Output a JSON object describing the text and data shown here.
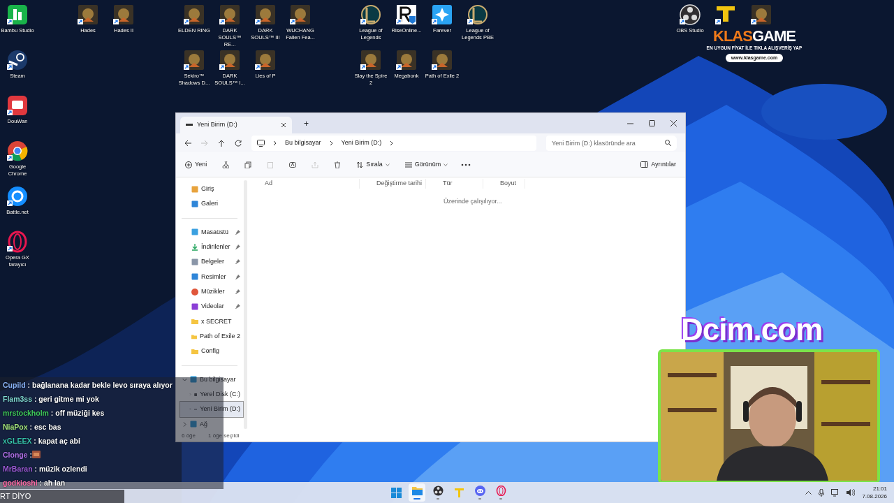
{
  "desktop_icons": [
    {
      "label": "Bambu Studio",
      "kind": "bambu"
    },
    {
      "label": "Steam",
      "kind": "steam"
    },
    {
      "label": "DouWan",
      "kind": "douwan"
    },
    {
      "label": "Google Chrome",
      "kind": "chrome"
    },
    {
      "label": "Battle.net",
      "kind": "battlenet"
    },
    {
      "label": "Opera GX tarayıcı",
      "kind": "opera"
    },
    {
      "label": "Hades",
      "kind": "game"
    },
    {
      "label": "Hades II",
      "kind": "game"
    },
    {
      "label": "ELDEN RING",
      "kind": "game"
    },
    {
      "label": "DARK SOULS™ RE...",
      "kind": "game"
    },
    {
      "label": "DARK SOULS™ III",
      "kind": "game"
    },
    {
      "label": "WUCHANG Fallen Fea...",
      "kind": "game"
    },
    {
      "label": "Sekiro™ Shadows D...",
      "kind": "game"
    },
    {
      "label": "DARK SOULS™ I...",
      "kind": "game"
    },
    {
      "label": "Lies of P",
      "kind": "game"
    },
    {
      "label": "League of Legends",
      "kind": "league"
    },
    {
      "label": "RiseOnline...",
      "kind": "rise"
    },
    {
      "label": "Farever",
      "kind": "farever"
    },
    {
      "label": "League of Legends PBE",
      "kind": "league"
    },
    {
      "label": "Slay the Spire 2",
      "kind": "game"
    },
    {
      "label": "Megabonk",
      "kind": "game"
    },
    {
      "label": "Path of Exile 2",
      "kind": "game"
    },
    {
      "label": "OBS Studio",
      "kind": "obs"
    },
    {
      "kind": "tft"
    },
    {
      "kind": "game"
    }
  ],
  "ad": {
    "brand_left": "KLAS",
    "brand_right": "GAME",
    "tagline": "EN UYGUN FİYAT İLE TIKLA ALIŞVERİŞ YAP",
    "url": "www.klasgame.com"
  },
  "explorer": {
    "tab_title": "Yeni Birim (D:)",
    "new_tab": "+",
    "breadcrumbs": [
      "Bu bilgisayar",
      "Yeni Birim (D:)"
    ],
    "search": {
      "placeholder": "Yeni Birim (D:) klasöründe ara"
    },
    "toolbar": {
      "new": "Yeni",
      "sort": "Sırala",
      "view": "Görünüm",
      "details": "Ayrıntılar"
    },
    "sidebar_top": [
      {
        "label": "Giriş",
        "kind": "home"
      },
      {
        "label": "Galeri",
        "kind": "gallery"
      }
    ],
    "quick_access": [
      {
        "label": "Masaüstü",
        "kind": "desktop",
        "pinned": true
      },
      {
        "label": "İndirilenler",
        "kind": "downloads",
        "pinned": true
      },
      {
        "label": "Belgeler",
        "kind": "documents",
        "pinned": true
      },
      {
        "label": "Resimler",
        "kind": "pictures",
        "pinned": true
      },
      {
        "label": "Müzikler",
        "kind": "music",
        "pinned": true
      },
      {
        "label": "Videolar",
        "kind": "videos",
        "pinned": true
      },
      {
        "label": "x SECRET",
        "kind": "folder",
        "pinned": false
      },
      {
        "label": "Path of Exile 2",
        "kind": "folder",
        "pinned": false
      },
      {
        "label": "Config",
        "kind": "folder",
        "pinned": false
      }
    ],
    "tree": [
      {
        "label": "Bu bilgisayar",
        "expanded": true,
        "selected": false,
        "children": [
          {
            "label": "Yerel Disk (C:)",
            "expanded": false,
            "selected": false
          },
          {
            "label": "Yeni Birim (D:)",
            "expanded": false,
            "selected": true
          }
        ]
      },
      {
        "label": "Ağ",
        "expanded": false,
        "selected": false
      }
    ],
    "columns": [
      "Ad",
      "Değiştirme tarihi",
      "Tür",
      "Boyut"
    ],
    "message": "Üzerinde çalışılıyor...",
    "status_bar": [
      "6 öğe",
      "1 öğe seçildi"
    ]
  },
  "chat": [
    {
      "user": "Cupild",
      "color": "#8ab4f8",
      "text": ": bağlanana kadar bekle levo sıraya alıyor"
    },
    {
      "user": "Flam3ss",
      "color": "#7fd8d0",
      "text": ": geri gitme mi yok"
    },
    {
      "user": "mrstockholm",
      "color": "#3ec95a",
      "text": ": off müziği kes"
    },
    {
      "user": "NiaPox",
      "color": "#a3e37a",
      "text": ": esc bas"
    },
    {
      "user": "xGLEEX",
      "color": "#35c0a8",
      "text": ": kapat aç abi"
    },
    {
      "user": "Clonge",
      "color": "#b070e8",
      "text": ":",
      "kind": "emote"
    },
    {
      "user": "MrBaran",
      "color": "#9b59d6",
      "text": ": müzik ozlendi"
    },
    {
      "user": "godkioshi",
      "color": "#ff6aa8",
      "text": ": ah lan"
    }
  ],
  "ticker": "RT DİYO",
  "overlay_brand": "Dcim.com",
  "taskbar": [
    {
      "kind": "start",
      "selected": false,
      "running": false
    },
    {
      "kind": "files",
      "selected": true,
      "running": true
    },
    {
      "kind": "obs",
      "selected": false,
      "running": true
    },
    {
      "kind": "tft",
      "selected": false,
      "running": false
    },
    {
      "kind": "discord",
      "selected": false,
      "running": true
    },
    {
      "kind": "opera",
      "selected": false,
      "running": true
    }
  ],
  "clock": {
    "time": "21:01",
    "date": "7.08.2026"
  }
}
